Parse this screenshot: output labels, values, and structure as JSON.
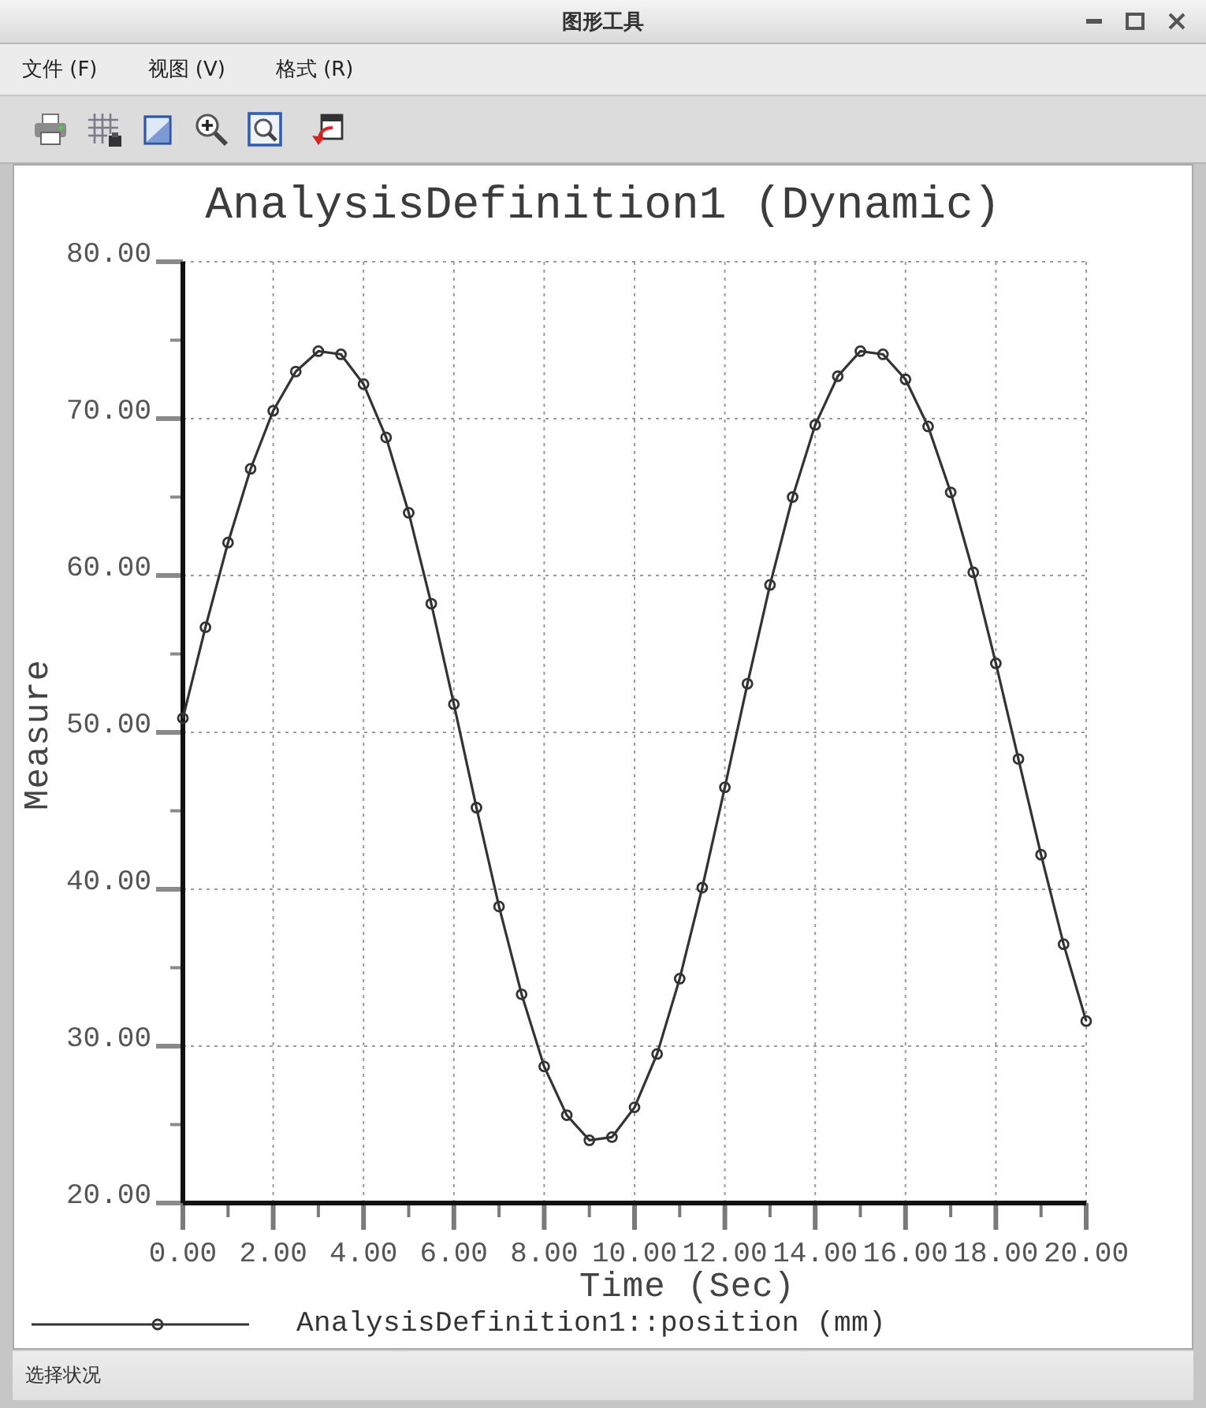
{
  "window": {
    "title": "图形工具"
  },
  "menu_bar": [
    "文件 (F)",
    "视图 (V)",
    "格式 (R)"
  ],
  "chart": {
    "chart_data": {
      "type": "line",
      "title": "AnalysisDefinition1 (Dynamic)",
      "xlabel": "Time (Sec)",
      "ylabel": "Measure",
      "grid": true,
      "x": [
        0,
        0.5,
        1,
        1.5,
        2,
        2.5,
        3,
        3.5,
        4,
        4.5,
        5,
        5.5,
        6,
        6.5,
        7,
        7.5,
        8,
        8.5,
        9,
        9.5,
        10,
        10.5,
        11,
        11.5,
        12,
        12.5,
        13,
        13.5,
        14,
        14.5,
        15,
        15.5,
        16,
        16.5,
        17,
        17.5,
        18,
        18.5,
        19,
        19.5,
        20
      ],
      "series": [
        {
          "name": "AnalysisDefinition1::position (mm)",
          "color": "#333333",
          "marker": "circle",
          "values": [
            50.9,
            56.7,
            62.1,
            66.8,
            70.5,
            73.0,
            74.3,
            74.1,
            72.2,
            68.8,
            64.0,
            58.2,
            51.8,
            45.2,
            38.9,
            33.3,
            28.7,
            25.6,
            24.0,
            24.2,
            26.1,
            29.5,
            34.3,
            40.1,
            46.5,
            53.1,
            59.4,
            65.0,
            69.6,
            72.7,
            74.3,
            74.1,
            72.5,
            69.5,
            65.3,
            60.2,
            54.4,
            48.3,
            42.2,
            36.5,
            31.6
          ]
        }
      ],
      "xlim": [
        0,
        20
      ],
      "ylim": [
        20,
        80
      ],
      "xticks": [
        {
          "value": 0,
          "label": "0.00"
        },
        {
          "value": 2,
          "label": "2.00"
        },
        {
          "value": 4,
          "label": "4.00"
        },
        {
          "value": 6,
          "label": "6.00"
        },
        {
          "value": 8,
          "label": "8.00"
        },
        {
          "value": 10,
          "label": "10.00"
        },
        {
          "value": 12,
          "label": "12.00"
        },
        {
          "value": 14,
          "label": "14.00"
        },
        {
          "value": 16,
          "label": "16.00"
        },
        {
          "value": 18,
          "label": "18.00"
        },
        {
          "value": 20,
          "label": "20.00"
        }
      ],
      "yticks": [
        {
          "value": 20,
          "label": "20.00"
        },
        {
          "value": 30,
          "label": "30.00"
        },
        {
          "value": 40,
          "label": "40.00"
        },
        {
          "value": 50,
          "label": "50.00"
        },
        {
          "value": 60,
          "label": "60.00"
        },
        {
          "value": 70,
          "label": "70.00"
        },
        {
          "value": 80,
          "label": "80.00"
        }
      ]
    }
  },
  "status_bar": {
    "text": "选择状况"
  }
}
